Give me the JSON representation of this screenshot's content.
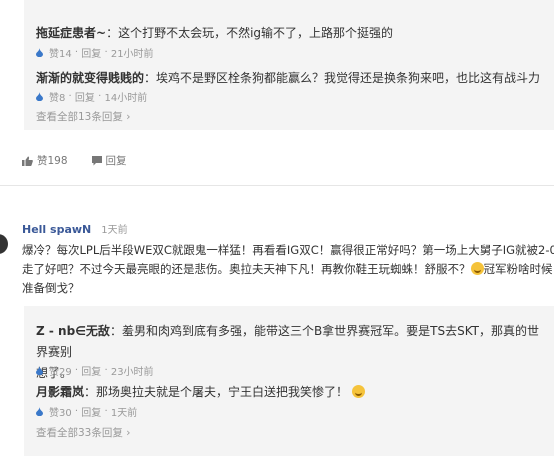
{
  "top_thread": {
    "replies": [
      {
        "name": "拖延症患者~",
        "text": "：这个打野不太会玩，不然ig输不了，上路那个挺强的",
        "likes": "赞14",
        "reply": "回复",
        "time": "21小时前"
      },
      {
        "name": "渐渐的就变得贱贱的",
        "text": "：埃鸡不是野区栓条狗都能赢么？我觉得还是换条狗来吧，也比这有战斗力",
        "likes": "赞8",
        "reply": "回复",
        "time": "14小时前"
      }
    ],
    "view_all": "查看全部13条回复",
    "actions": {
      "like": "赞198",
      "reply": "回复"
    }
  },
  "comment": {
    "username": "Hell spawN",
    "time": "1天前",
    "text_parts": [
      "爆冷？每次LPL后半段WE双C就跟鬼一样猛！再看看IG双C！赢得很正常好吗？第一场上大舅子IG就被2-0带",
      "走了好吧？不过今天最亮眼的还是悲伤。奥拉夫天神下凡！再教你鞋王玩蜘蛛！舒服不？",
      "冠军粉啥时候",
      "准备倒戈？"
    ],
    "replies": [
      {
        "name": "Z - nb∈无敌",
        "text_line1": "：羞男和肉鸡到底有多强，能带这三个B拿世界赛冠军。要是TS去SKT，那真的世界赛别",
        "text_line2": "想了。",
        "likes": "赞29",
        "reply": "回复",
        "time": "23小时前"
      },
      {
        "name": "月影霜岚",
        "text": "：那场奥拉夫就是个屠夫，宁王白送把我笑惨了！",
        "likes": "赞30",
        "reply": "回复",
        "time": "1天前"
      }
    ],
    "view_all": "查看全部33条回复"
  },
  "colors": {
    "accent": "#3b5998",
    "muted": "#999999",
    "panel": "#f4f4f4"
  }
}
